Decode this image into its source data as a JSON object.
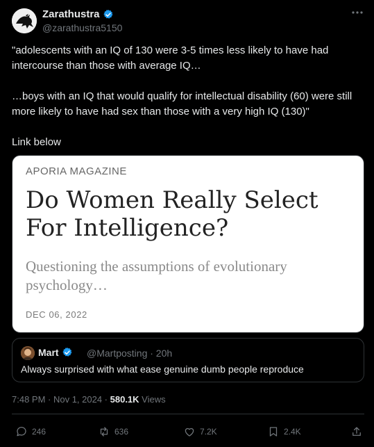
{
  "author": {
    "display_name": "Zarathustra",
    "handle": "@zarathustra5150"
  },
  "tweet": {
    "line1": "\"adolescents with an IQ of 130 were 3-5 times less likely to have had intercourse than those with average IQ…",
    "line2": "…boys with an IQ that would qualify for intellectual disability (60) were still more likely to have had sex than those with a very high IQ (130)\"",
    "line3": "Link below"
  },
  "card": {
    "source": "APORIA MAGAZINE",
    "title": "Do Women Really Select For Intelligence?",
    "subtitle": "Questioning the assumptions of evolutionary psychology…",
    "date": "DEC 06, 2022"
  },
  "quote": {
    "display_name": "Mart",
    "handle_time": "@Martposting · 20h",
    "text": "Always surprised with what ease genuine dumb people reproduce"
  },
  "meta": {
    "timestamp": "7:48 PM · Nov 1, 2024 · ",
    "views_count": "580.1K",
    "views_label": " Views"
  },
  "actions": {
    "replies": "246",
    "reposts": "636",
    "likes": "7.2K",
    "bookmarks": "2.4K"
  },
  "colors": {
    "background": "#000000",
    "text": "#e7e9ea",
    "muted": "#71767b",
    "verified": "#1d9bf0"
  },
  "icons": [
    "avatar-bird",
    "verified-badge-icon",
    "more-options-icon",
    "reply-icon",
    "repost-icon",
    "like-icon",
    "bookmark-icon",
    "share-icon"
  ]
}
